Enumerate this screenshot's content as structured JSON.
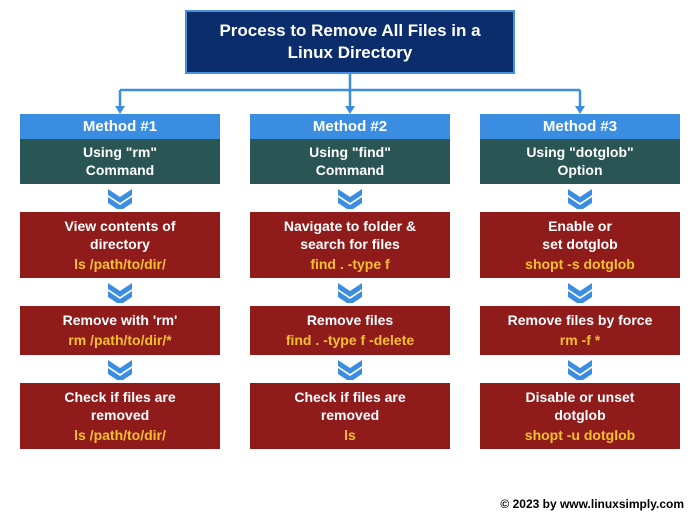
{
  "title": "Process to Remove All Files in a Linux Directory",
  "columns": [
    {
      "header": "Method #1",
      "sub": "Using \"rm\"\nCommand",
      "steps": [
        {
          "desc": "View contents of\ndirectory",
          "cmd": "ls /path/to/dir/"
        },
        {
          "desc": "Remove with 'rm'",
          "cmd": "rm /path/to/dir/*"
        },
        {
          "desc": "Check if files are\nremoved",
          "cmd": "ls /path/to/dir/"
        }
      ]
    },
    {
      "header": "Method #2",
      "sub": "Using \"find\"\nCommand",
      "steps": [
        {
          "desc": "Navigate to folder &\nsearch for files",
          "cmd": "find . -type f"
        },
        {
          "desc": "Remove files",
          "cmd": "find . -type f -delete"
        },
        {
          "desc": "Check if files are\nremoved",
          "cmd": "ls"
        }
      ]
    },
    {
      "header": "Method #3",
      "sub": "Using \"dotglob\"\nOption",
      "steps": [
        {
          "desc": "Enable or\nset dotglob",
          "cmd": "shopt -s dotglob"
        },
        {
          "desc": "Remove files by force",
          "cmd": "rm  -f  *"
        },
        {
          "desc": "Disable or unset\ndotglob",
          "cmd": "shopt -u dotglob"
        }
      ]
    }
  ],
  "footer": "© 2023 by www.linuxsimply.com"
}
